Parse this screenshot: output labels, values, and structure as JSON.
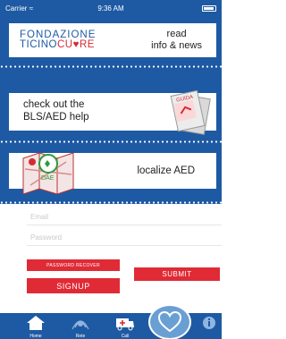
{
  "status_bar": {
    "carrier": "Carrier",
    "time": "9:36 AM"
  },
  "menu": {
    "logo": {
      "line1": "FONDAZIONE",
      "line2_left": "TICINO",
      "line2_right": "CU",
      "line2_heart": "♥",
      "line2_end": "RE"
    },
    "read_news": {
      "line1": "read",
      "line2": "info & news"
    },
    "bls_help": {
      "line1": "check out the",
      "line2": "BLS/AED help"
    },
    "guide_label": "GUIDA",
    "localize_aed": "localize AED",
    "dae_label": "DAE"
  },
  "form": {
    "email_placeholder": "Email",
    "password_placeholder": "Password",
    "password_recover": "PASSWORD RECOVER",
    "submit": "SUBMIT",
    "signup": "SIGNUP"
  },
  "tab_bar": {
    "tabs": [
      {
        "label": "Home"
      },
      {
        "label": "Rete"
      },
      {
        "label": "Call"
      }
    ]
  },
  "colors": {
    "primary_blue": "#1e5aa3",
    "accent_red": "#e02b36",
    "heart_blue": "#6a9fd4"
  }
}
